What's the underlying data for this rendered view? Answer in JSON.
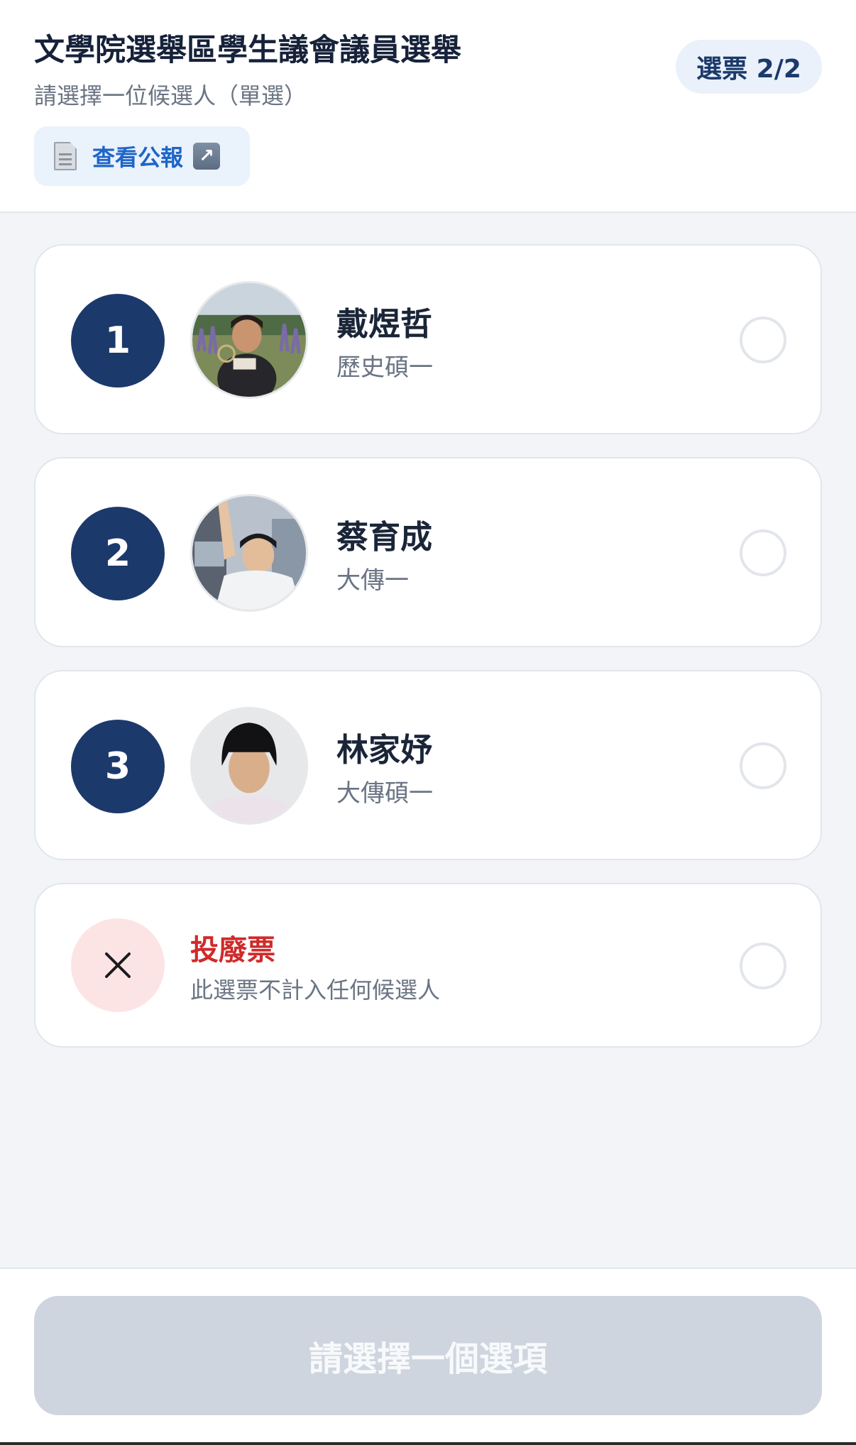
{
  "header": {
    "title": "文學院選舉區學生議會議員選舉",
    "subtitle": "請選擇一位候選人（單選）",
    "ballot_badge": "選票 2/2",
    "bulletin_label": "查看公報",
    "bulletin_icon": "document-icon",
    "external_icon": "external-link-icon"
  },
  "candidates": [
    {
      "number": "1",
      "name": "戴煜哲",
      "dept": "歷史碩一"
    },
    {
      "number": "2",
      "name": "蔡育成",
      "dept": "大傳一"
    },
    {
      "number": "3",
      "name": "林家妤",
      "dept": "大傳碩一"
    }
  ],
  "invalid_vote": {
    "title": "投廢票",
    "desc": "此選票不計入任何候選人",
    "icon": "close-icon"
  },
  "submit": {
    "label": "請選擇一個選項"
  },
  "colors": {
    "accent": "#1c396b",
    "link": "#1f65c7",
    "danger": "#d02a2a",
    "danger_bg": "#fde4e4",
    "disabled_button": "#cfd5de"
  }
}
